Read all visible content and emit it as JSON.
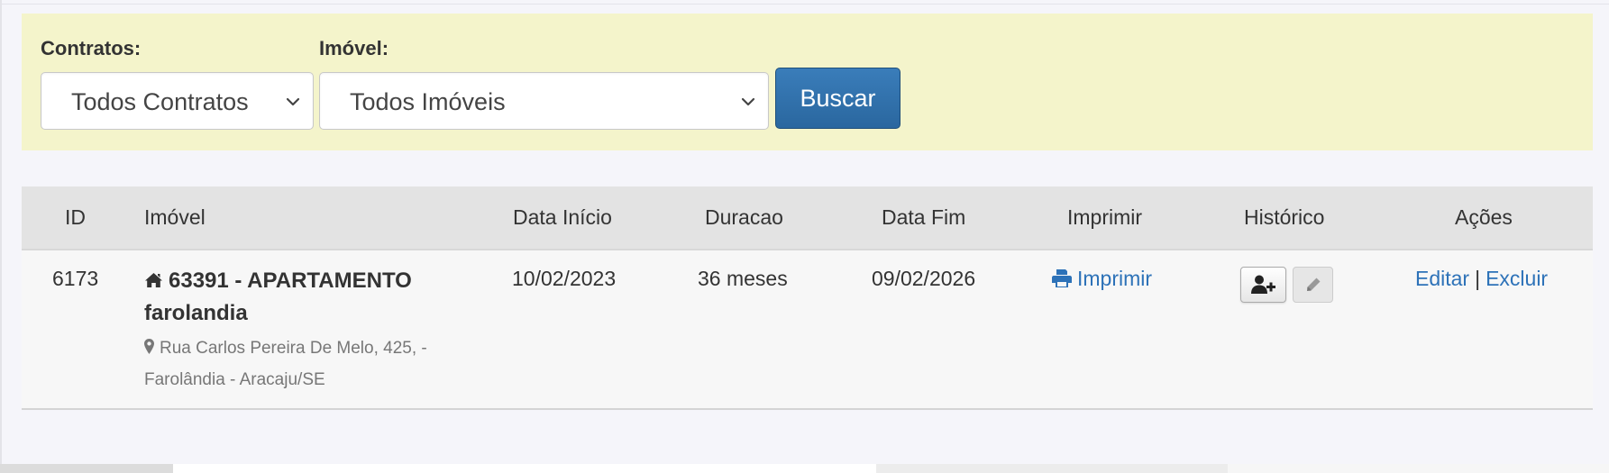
{
  "filters": {
    "contracts_label": "Contratos:",
    "contracts_value": "Todos Contratos",
    "property_label": "Imóvel:",
    "property_value": "Todos Imóveis",
    "search_button": "Buscar"
  },
  "table": {
    "headers": {
      "id": "ID",
      "property": "Imóvel",
      "start_date": "Data Início",
      "duration": "Duracao",
      "end_date": "Data Fim",
      "print": "Imprimir",
      "history": "Histórico",
      "actions": "Ações"
    },
    "rows": [
      {
        "id": "6173",
        "property_title": "63391 - APARTAMENTO farolandia",
        "address": "Rua Carlos Pereira De Melo, 425, - Farolândia - Aracaju/SE",
        "start_date": "10/02/2023",
        "duration": "36 meses",
        "end_date": "09/02/2026",
        "print_link": "Imprimir",
        "edit_link": "Editar",
        "separator": "|",
        "delete_link": "Excluir"
      }
    ]
  },
  "icons": {
    "home": "home-icon",
    "pin": "map-marker-icon",
    "print": "print-icon",
    "add_user": "user-plus-icon",
    "edit": "pencil-icon",
    "chevron": "chevron-down-icon"
  },
  "colors": {
    "filter_panel": "#f4f4cb",
    "primary_button": "#2a679f",
    "link": "#2d72b8",
    "table_header": "#e3e3e3"
  }
}
